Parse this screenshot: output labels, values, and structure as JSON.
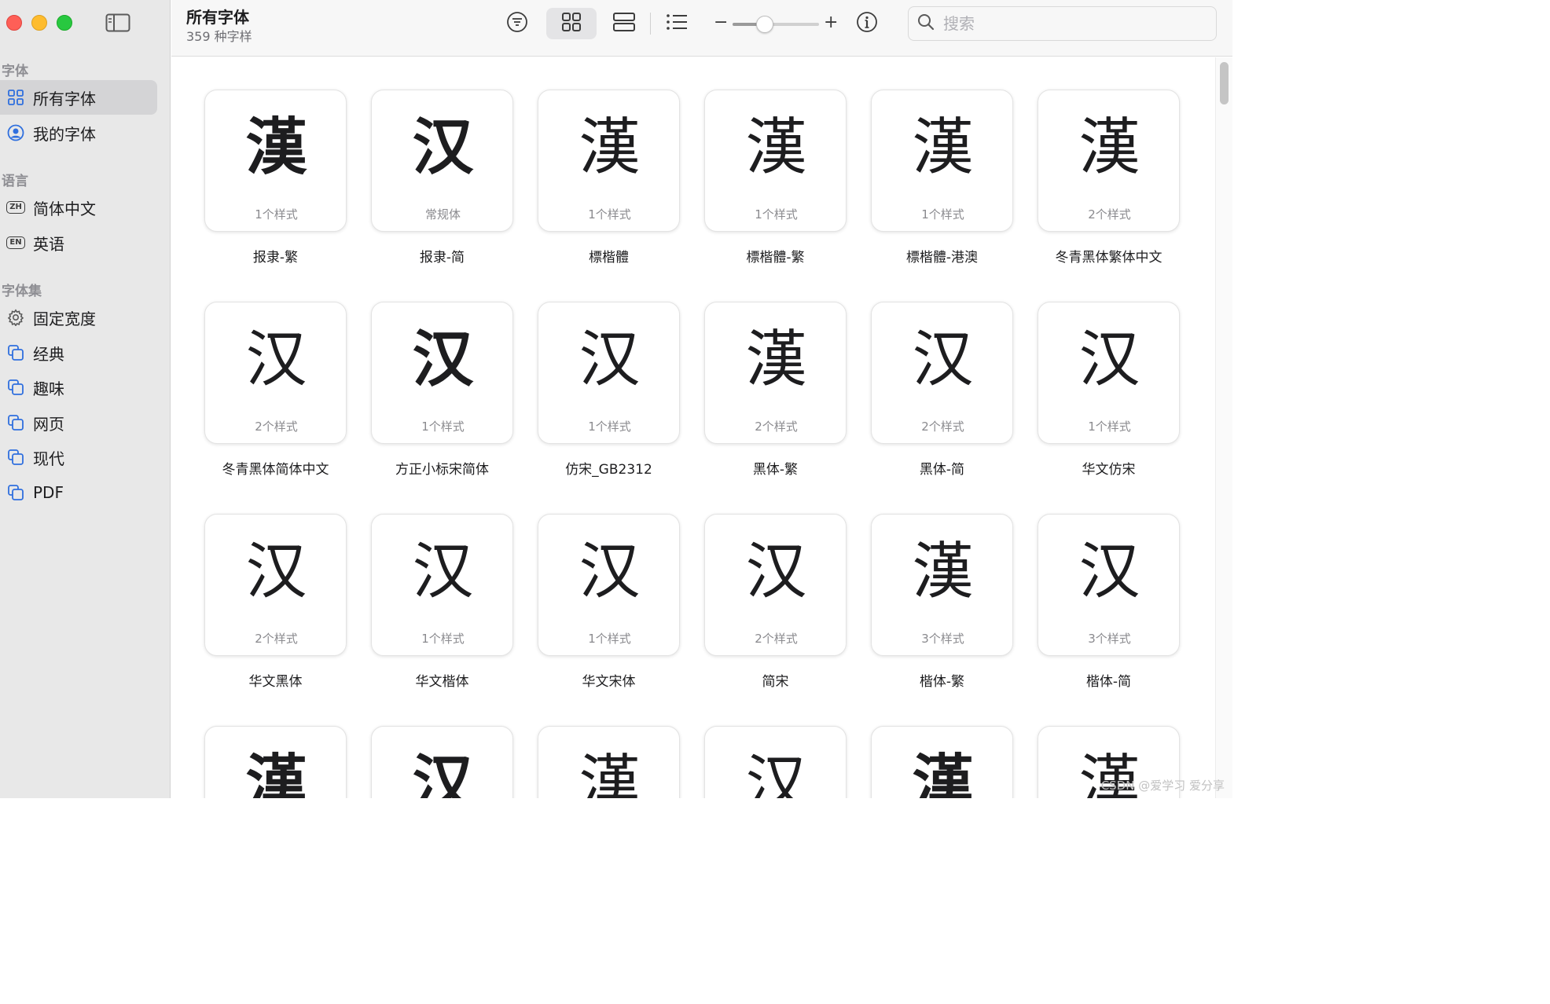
{
  "window": {
    "title": "所有字体",
    "subtitle": "359 种字样"
  },
  "sidebar": {
    "sections": [
      {
        "title": "字体",
        "items": [
          {
            "label": "所有字体",
            "icon": "grid-icon",
            "active": true
          },
          {
            "label": "我的字体",
            "icon": "person-circle-icon",
            "active": false
          }
        ]
      },
      {
        "title": "语言",
        "items": [
          {
            "label": "简体中文",
            "icon": "ZH",
            "active": false
          },
          {
            "label": "英语",
            "icon": "EN",
            "active": false
          }
        ]
      },
      {
        "title": "字体集",
        "items": [
          {
            "label": "固定宽度",
            "icon": "gear-icon",
            "active": false
          },
          {
            "label": "经典",
            "icon": "collection-icon",
            "active": false
          },
          {
            "label": "趣味",
            "icon": "collection-icon",
            "active": false
          },
          {
            "label": "网页",
            "icon": "collection-icon",
            "active": false
          },
          {
            "label": "现代",
            "icon": "collection-icon",
            "active": false
          },
          {
            "label": "PDF",
            "icon": "collection-icon",
            "active": false
          }
        ]
      }
    ]
  },
  "toolbar": {
    "zoom_minus": "−",
    "zoom_plus": "+",
    "zoom_level": 0.37,
    "search_placeholder": "搜索"
  },
  "fonts": [
    {
      "glyph": "漢",
      "styles": "1个样式",
      "name": "报隶-繁",
      "face": "sans-bold"
    },
    {
      "glyph": "汉",
      "styles": "常规体",
      "name": "报隶-简",
      "face": "sans-bold"
    },
    {
      "glyph": "漢",
      "styles": "1个样式",
      "name": "標楷體",
      "face": "serif"
    },
    {
      "glyph": "漢",
      "styles": "1个样式",
      "name": "標楷體-繁",
      "face": "serif"
    },
    {
      "glyph": "漢",
      "styles": "1个样式",
      "name": "標楷體-港澳",
      "face": "serif"
    },
    {
      "glyph": "漢",
      "styles": "2个样式",
      "name": "冬青黑体繁体中文",
      "face": "sans"
    },
    {
      "glyph": "汉",
      "styles": "2个样式",
      "name": "冬青黑体简体中文",
      "face": "sans"
    },
    {
      "glyph": "汉",
      "styles": "1个样式",
      "name": "方正小标宋简体",
      "face": "serif-bold"
    },
    {
      "glyph": "汉",
      "styles": "1个样式",
      "name": "仿宋_GB2312",
      "face": "serif"
    },
    {
      "glyph": "漢",
      "styles": "2个样式",
      "name": "黑体-繁",
      "face": "sans"
    },
    {
      "glyph": "汉",
      "styles": "2个样式",
      "name": "黑体-简",
      "face": "sans"
    },
    {
      "glyph": "汉",
      "styles": "1个样式",
      "name": "华文仿宋",
      "face": "serif"
    },
    {
      "glyph": "汉",
      "styles": "2个样式",
      "name": "华文黑体",
      "face": "sans"
    },
    {
      "glyph": "汉",
      "styles": "1个样式",
      "name": "华文楷体",
      "face": "serif"
    },
    {
      "glyph": "汉",
      "styles": "1个样式",
      "name": "华文宋体",
      "face": "serif"
    },
    {
      "glyph": "汉",
      "styles": "2个样式",
      "name": "简宋",
      "face": "serif"
    },
    {
      "glyph": "漢",
      "styles": "3个样式",
      "name": "楷体-繁",
      "face": "serif"
    },
    {
      "glyph": "汉",
      "styles": "3个样式",
      "name": "楷体-简",
      "face": "serif"
    },
    {
      "glyph": "漢",
      "styles": "",
      "name": "",
      "face": "sans-bold"
    },
    {
      "glyph": "汉",
      "styles": "",
      "name": "",
      "face": "sans-bold"
    },
    {
      "glyph": "漢",
      "styles": "",
      "name": "",
      "face": "serif"
    },
    {
      "glyph": "汉",
      "styles": "",
      "name": "",
      "face": "serif"
    },
    {
      "glyph": "漢",
      "styles": "",
      "name": "",
      "face": "sans-bold"
    },
    {
      "glyph": "漢",
      "styles": "",
      "name": "",
      "face": "serif"
    }
  ],
  "watermark": "CSDN @爱学习 爱分享"
}
